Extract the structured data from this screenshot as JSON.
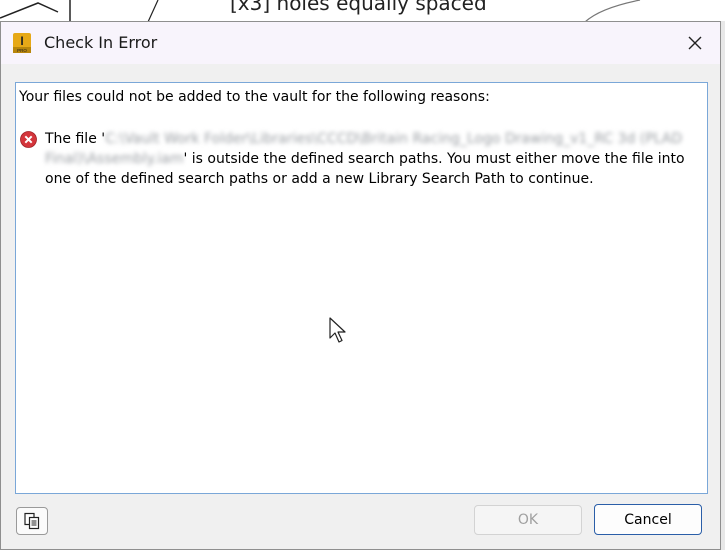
{
  "background": {
    "drawing_text": "[x3] holes equally spaced"
  },
  "dialog": {
    "title": "Check In Error",
    "heading": "Your files could not be added to the vault for the following reasons:",
    "error": {
      "prefix": "The file '",
      "path_blurred": "C:\\Vault Work Folder\\Libraries\\CCCD\\Britain Racing_Logo Drawing_v1_RC 3d (PLAD Final)\\Assembly.iam",
      "suffix": "' is outside the defined search paths.  You must either move the file into one of the defined search paths or add a new Library Search Path to continue."
    },
    "buttons": {
      "ok": "OK",
      "cancel": "Cancel"
    },
    "icons": {
      "app": "autodesk-inventor-icon",
      "error": "error-icon",
      "close": "close-icon",
      "copy": "copy-icon"
    },
    "colors": {
      "error_red": "#d4353b",
      "accent_blue": "#2a5ea8"
    }
  }
}
